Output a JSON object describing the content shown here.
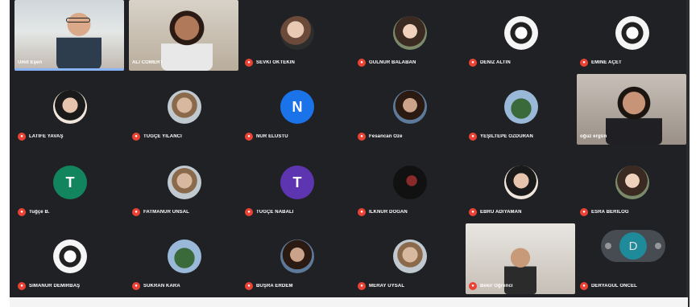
{
  "colors": {
    "background": "#202124",
    "mic_muted": "#ea4335",
    "active_speaker": "#8ab4f8"
  },
  "participants": [
    {
      "name": "Ümit Eşen",
      "kind": "video"
    },
    {
      "name": "Ali Cömert",
      "kind": "video"
    },
    {
      "name": "SEVKİ ÖKTEKİN",
      "kind": "photo"
    },
    {
      "name": "GÜLNUR BALABAN",
      "kind": "photo"
    },
    {
      "name": "DENİZ ALTIN",
      "kind": "photo"
    },
    {
      "name": "EMİNE AÇET",
      "kind": "photo"
    },
    {
      "name": "LATİFE YAVAŞ",
      "kind": "photo"
    },
    {
      "name": "TUĞÇE YILANCI",
      "kind": "photo"
    },
    {
      "name": "NUR ELÜSTÜ",
      "kind": "letter",
      "initial": "N",
      "color": "#1a73e8"
    },
    {
      "name": "Fesancan Öze",
      "kind": "photo"
    },
    {
      "name": "YEŞİLTEPE ÖZDURAN",
      "kind": "photo"
    },
    {
      "name": "oğuz ergün",
      "kind": "video"
    },
    {
      "name": "Tuğçe B.",
      "kind": "letter",
      "initial": "T",
      "color": "#12855e"
    },
    {
      "name": "FATMANUR ÜNSAL",
      "kind": "photo"
    },
    {
      "name": "TUĞÇE NABALI",
      "kind": "letter",
      "initial": "T",
      "color": "#5e35b1"
    },
    {
      "name": "İLKNUR DOĞAN",
      "kind": "photo"
    },
    {
      "name": "EBRU ADIYAMAN",
      "kind": "photo"
    },
    {
      "name": "ESRA BERİLOĞ",
      "kind": "photo"
    },
    {
      "name": "SİMANUR DEMİRBAŞ",
      "kind": "photo"
    },
    {
      "name": "SUKRAN KARA",
      "kind": "photo"
    },
    {
      "name": "BÜŞRA ERDEM",
      "kind": "photo"
    },
    {
      "name": "MERAY UYSAL",
      "kind": "photo"
    },
    {
      "name": "Bekir Öğrenci",
      "kind": "video"
    },
    {
      "name": "DERYAGÜL ÖNCEL",
      "kind": "ghost",
      "initial": "D"
    }
  ]
}
